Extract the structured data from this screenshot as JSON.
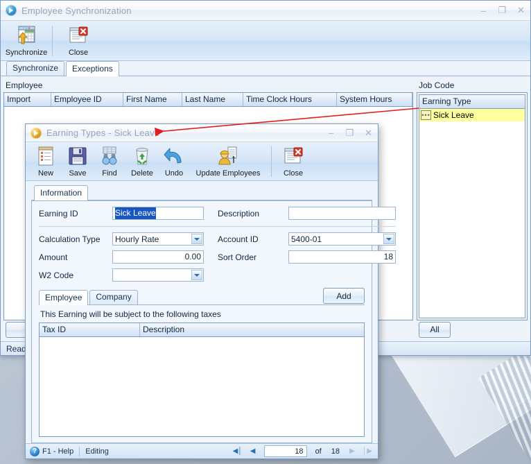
{
  "main_window": {
    "title": "Employee Synchronization",
    "icon": "app-orb-icon",
    "window_buttons": {
      "minimize": "–",
      "maximize": "❐",
      "close": "✕"
    },
    "toolbar": [
      {
        "label": "Synchronize",
        "icon": "synchronize-icon"
      },
      {
        "label": "Close",
        "icon": "close-window-icon"
      }
    ],
    "tabs": [
      {
        "label": "Synchronize",
        "active": false
      },
      {
        "label": "Exceptions",
        "active": true
      }
    ],
    "employee_panel": {
      "label": "Employee",
      "columns": [
        "Import",
        "Employee ID",
        "First Name",
        "Last Name",
        "Time Clock Hours",
        "System Hours"
      ],
      "rows": []
    },
    "job_code_panel": {
      "label": "Job Code",
      "columns": [
        "Earning Type"
      ],
      "rows": [
        {
          "icon": "list-dots-icon",
          "label": "Sick Leave",
          "selected": true
        }
      ],
      "button": "All"
    },
    "status": "Ready"
  },
  "dialog": {
    "title": "Earning Types - Sick Leave",
    "icon": "app-orb-gold-icon",
    "window_buttons": {
      "minimize": "–",
      "maximize": "❐",
      "close": "✕"
    },
    "toolbar": [
      {
        "label": "New",
        "icon": "new-document-icon"
      },
      {
        "label": "Save",
        "icon": "floppy-disk-icon"
      },
      {
        "label": "Find",
        "icon": "binoculars-icon"
      },
      {
        "label": "Delete",
        "icon": "recycle-bin-icon"
      },
      {
        "label": "Undo",
        "icon": "undo-arrow-icon"
      },
      {
        "label": "Update Employees",
        "icon": "update-employees-icon"
      },
      {
        "label": "Close",
        "icon": "close-window-icon"
      }
    ],
    "tabs": [
      {
        "label": "Information",
        "active": true
      }
    ],
    "form": {
      "earning_id_label": "Earning ID",
      "earning_id_value": "Sick Leave",
      "description_label": "Description",
      "description_value": "",
      "calculation_type_label": "Calculation Type",
      "calculation_type_value": "Hourly Rate",
      "account_id_label": "Account ID",
      "account_id_value": "5400-01",
      "amount_label": "Amount",
      "amount_value": "0.00",
      "sort_order_label": "Sort Order",
      "sort_order_value": "18",
      "w2_code_label": "W2 Code",
      "w2_code_value": ""
    },
    "sub_tabs": [
      {
        "label": "Employee",
        "active": true
      },
      {
        "label": "Company",
        "active": false
      }
    ],
    "add_button": "Add",
    "tax_note": "This Earning will be subject to the following taxes",
    "tax_grid": {
      "columns": [
        "Tax ID",
        "Description"
      ],
      "rows": []
    },
    "status": {
      "help": "F1 - Help",
      "mode": "Editing",
      "record_value": "18",
      "of_label": "of",
      "record_total": "18",
      "nav_first": "◀│",
      "nav_prev": "◀",
      "nav_next": "▶",
      "nav_last": "│▶"
    }
  },
  "annotation": {
    "type": "red-arrow",
    "from": "Sick Leave list row",
    "to": "Earning Types - Sick Leave dialog title",
    "color": "#e02020"
  }
}
